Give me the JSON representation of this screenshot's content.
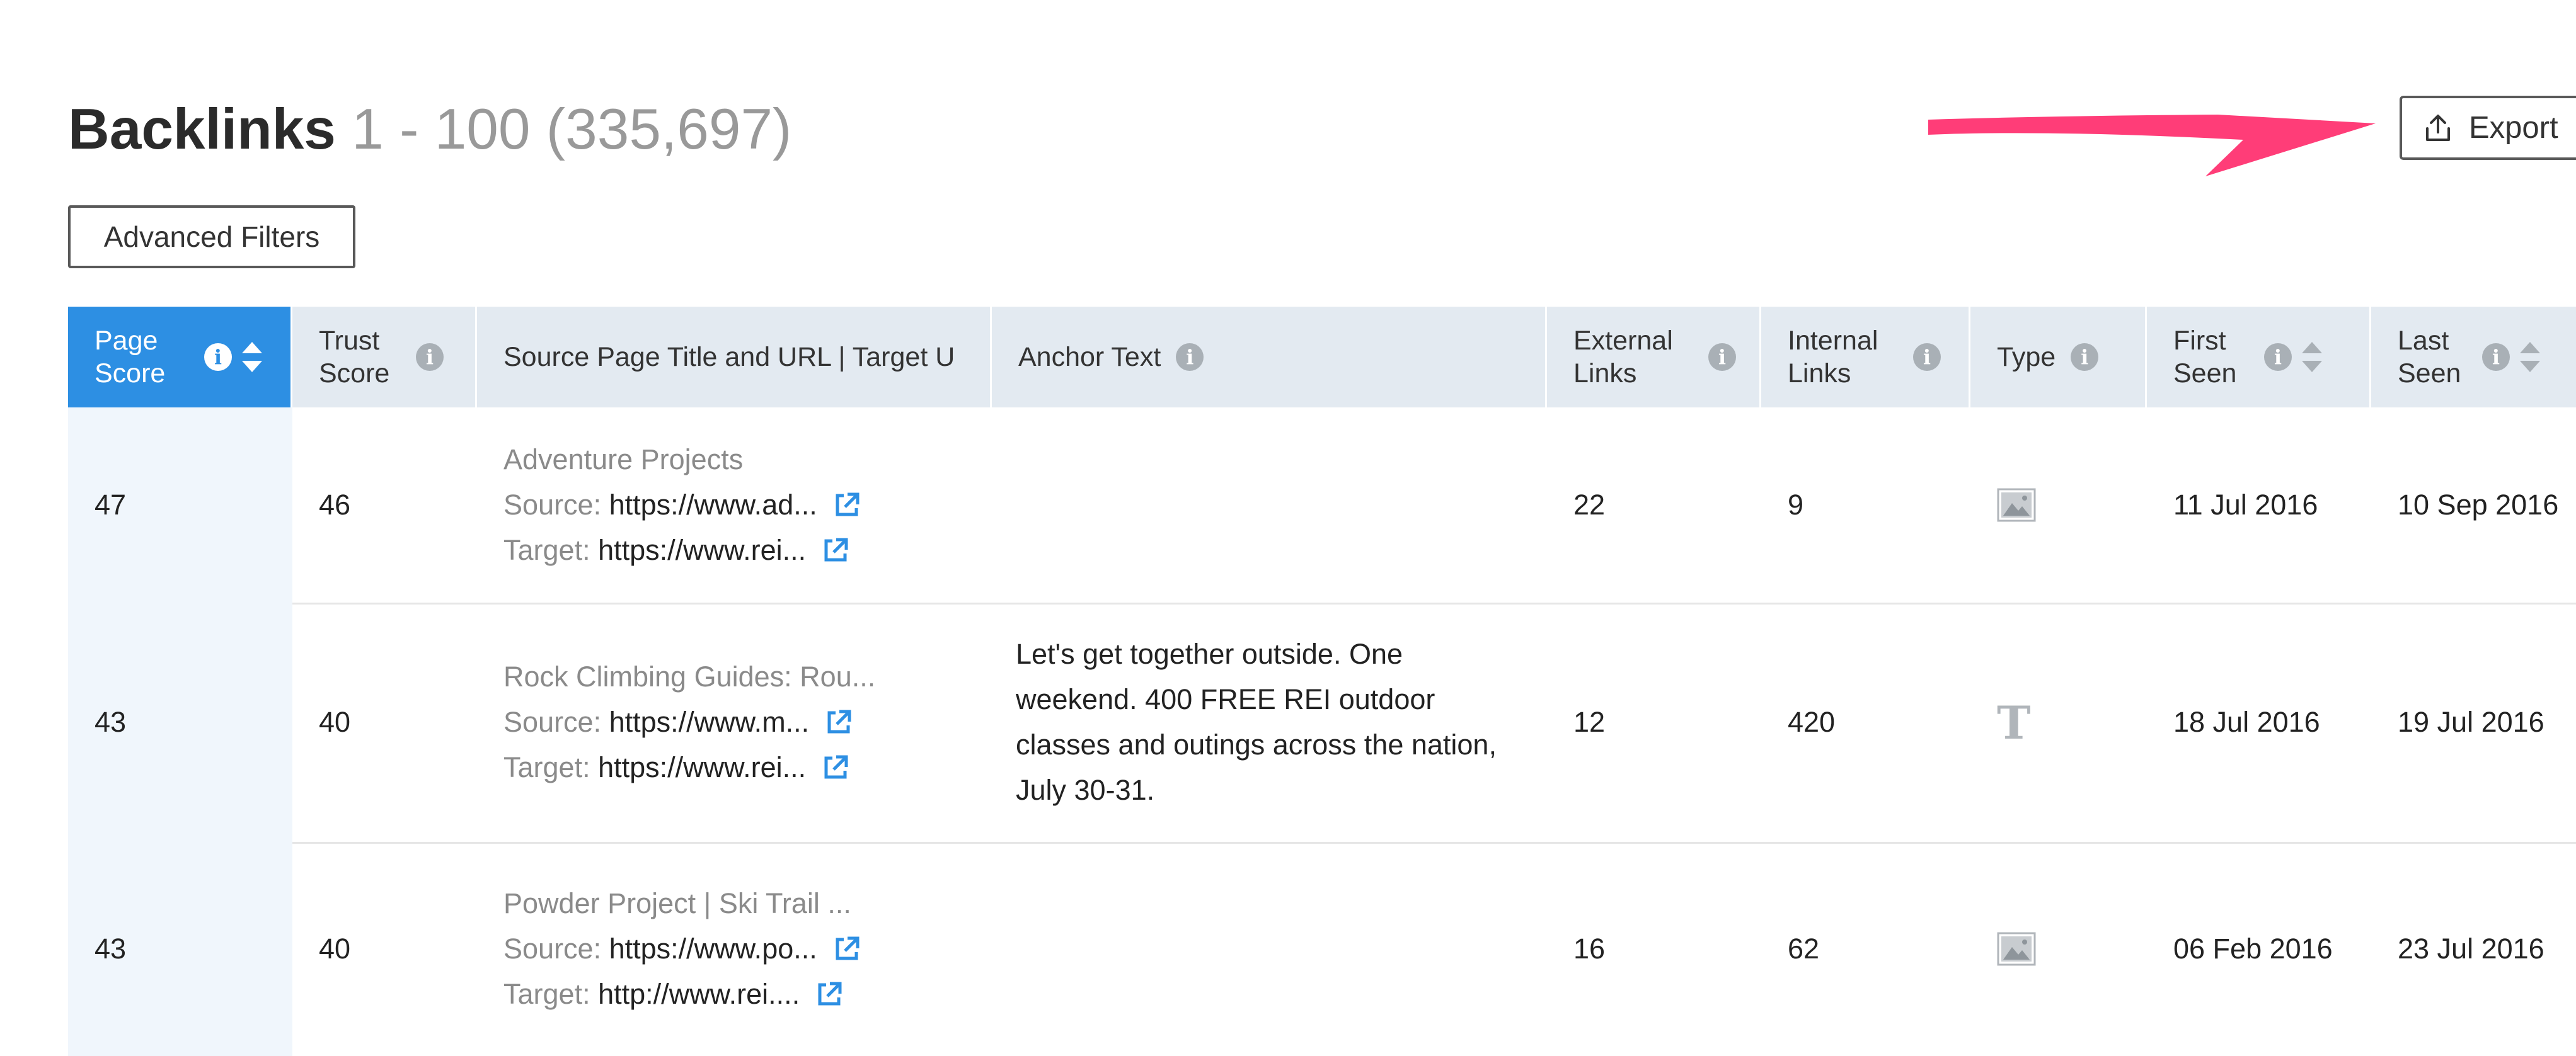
{
  "header": {
    "title": "Backlinks",
    "range": "1 - 100 (335,697)"
  },
  "toolbar": {
    "advanced_filters_label": "Advanced Filters",
    "export_label": "Export"
  },
  "colors": {
    "accent": "#2d8fe3",
    "annotation_arrow": "#ff3d78",
    "header_bg": "#e3eaf1"
  },
  "table": {
    "columns": [
      {
        "label": "Page Score",
        "info": true,
        "sort": true,
        "active": true
      },
      {
        "label": "Trust Score",
        "info": true,
        "sort": false
      },
      {
        "label": "Source Page Title and URL | Target U",
        "info": false,
        "sort": false
      },
      {
        "label": "Anchor Text",
        "info": true,
        "sort": false
      },
      {
        "label": "External Links",
        "info": true,
        "sort": false
      },
      {
        "label": "Internal Links",
        "info": true,
        "sort": false
      },
      {
        "label": "Type",
        "info": true,
        "sort": false
      },
      {
        "label": "First Seen",
        "info": true,
        "sort": true
      },
      {
        "label": "Last Seen",
        "info": true,
        "sort": true
      }
    ],
    "source_label": "Source:",
    "target_label": "Target:",
    "rows": [
      {
        "page_score": "47",
        "trust_score": "46",
        "page_title": "Adventure Projects",
        "source_url": "https://www.ad...",
        "target_url": "https://www.rei...",
        "anchor_text": "",
        "external_links": "22",
        "internal_links": "9",
        "type": "image-icon",
        "first_seen": "11 Jul 2016",
        "last_seen": "10 Sep 2016"
      },
      {
        "page_score": "43",
        "trust_score": "40",
        "page_title": "Rock Climbing Guides: Rou...",
        "source_url": "https://www.m...",
        "target_url": "https://www.rei...",
        "anchor_text": "Let's get together outside. One weekend. 400 FREE REI outdoor classes and outings across the nation, July 30-31.",
        "external_links": "12",
        "internal_links": "420",
        "type": "T",
        "first_seen": "18 Jul 2016",
        "last_seen": "19 Jul 2016"
      },
      {
        "page_score": "43",
        "trust_score": "40",
        "page_title": "Powder Project | Ski Trail ...",
        "source_url": "https://www.po...",
        "target_url": "http://www.rei....",
        "anchor_text": "",
        "external_links": "16",
        "internal_links": "62",
        "type": "image-icon",
        "first_seen": "06 Feb 2016",
        "last_seen": "23 Jul 2016"
      }
    ]
  }
}
